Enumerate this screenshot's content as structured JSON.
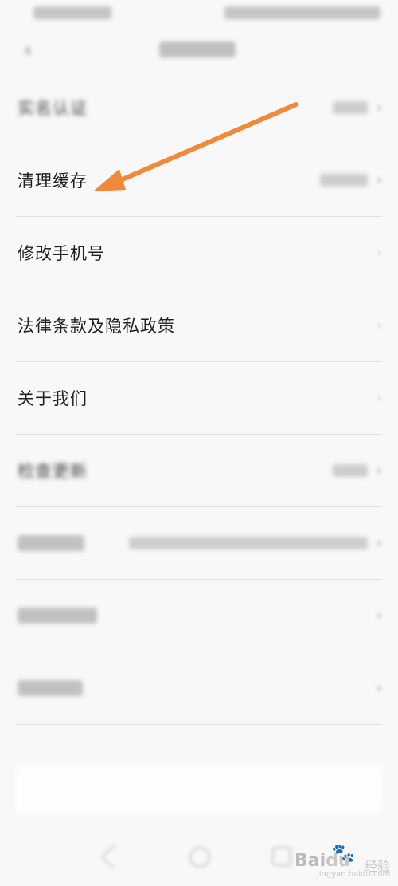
{
  "header": {
    "back_icon": "chevron-left-icon"
  },
  "settings": {
    "items": [
      {
        "label": "实名认证"
      },
      {
        "label": "清理缓存"
      },
      {
        "label": "修改手机号"
      },
      {
        "label": "法律条款及隐私政策"
      },
      {
        "label": "关于我们"
      },
      {
        "label": "检查更新"
      },
      {
        "label": ""
      },
      {
        "label": ""
      },
      {
        "label": ""
      }
    ],
    "chevron": "›"
  },
  "annotation": {
    "arrow_color": "#f0893a"
  },
  "watermark": {
    "brand_latin": "Bai",
    "brand_suffix": "du",
    "brand_cn": "经验",
    "sub": "jingyan.baidu.com"
  }
}
